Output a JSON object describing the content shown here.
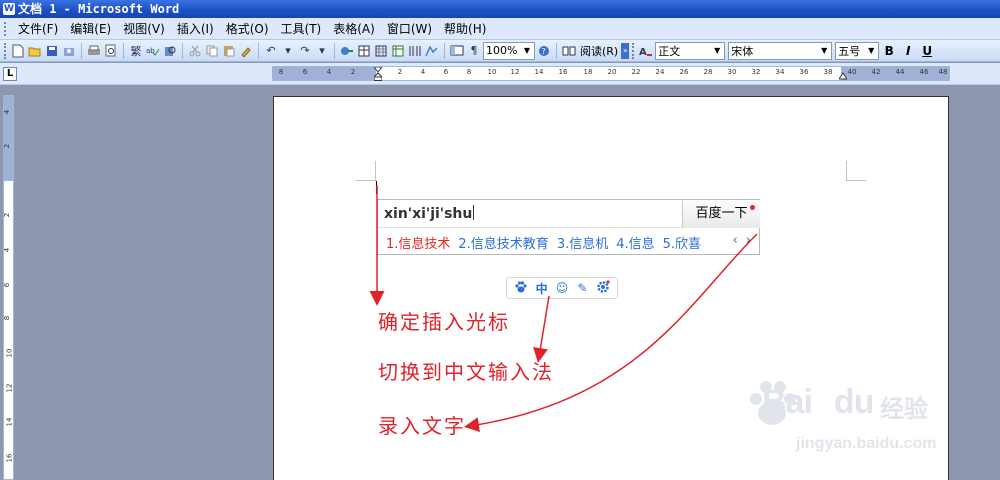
{
  "window": {
    "title": "文档 1 - Microsoft Word"
  },
  "menu": {
    "items": [
      "文件(F)",
      "编辑(E)",
      "视图(V)",
      "插入(I)",
      "格式(O)",
      "工具(T)",
      "表格(A)",
      "窗口(W)",
      "帮助(H)"
    ]
  },
  "toolbar": {
    "zoom": "100%",
    "read_label": "阅读(R)",
    "style": "正文",
    "font": "宋体",
    "size": "五号",
    "bold": "B",
    "italic": "I",
    "underline": "U",
    "traditional_label": "繁"
  },
  "ruler": {
    "tab_selector": "L",
    "h_numbers": [
      "8",
      "6",
      "4",
      "2",
      "2",
      "4",
      "6",
      "8",
      "10",
      "12",
      "14",
      "16",
      "18",
      "20",
      "22",
      "24",
      "26",
      "28",
      "30",
      "32",
      "34",
      "36",
      "38",
      "40",
      "42",
      "44",
      "46",
      "48"
    ],
    "v_numbers": [
      "4",
      "2",
      "2",
      "4",
      "6",
      "8",
      "10",
      "12",
      "14",
      "16"
    ]
  },
  "ime": {
    "input": "xin'xi'ji'shu",
    "search_button": "百度一下",
    "candidates": [
      "1.信息技术",
      "2.信息技术教育",
      "3.信息机",
      "4.信息",
      "5.欣喜"
    ],
    "nav": "‹ ›",
    "status": {
      "paw": "🐾",
      "mode": "中",
      "emoji": "☺",
      "pen": "✎",
      "settings": "⚙"
    }
  },
  "annotations": {
    "step1": "确定插入光标",
    "step2": "切换到中文输入法",
    "step3": "录入文字"
  },
  "watermark": {
    "brand": "Bai",
    "brand2": "du",
    "cn": "经验",
    "url": "jingyan.baidu.com"
  },
  "colors": {
    "annotation_red": "#e0232a",
    "candidate_blue": "#2a6fd6",
    "title_blue": "#1a4fc4"
  }
}
